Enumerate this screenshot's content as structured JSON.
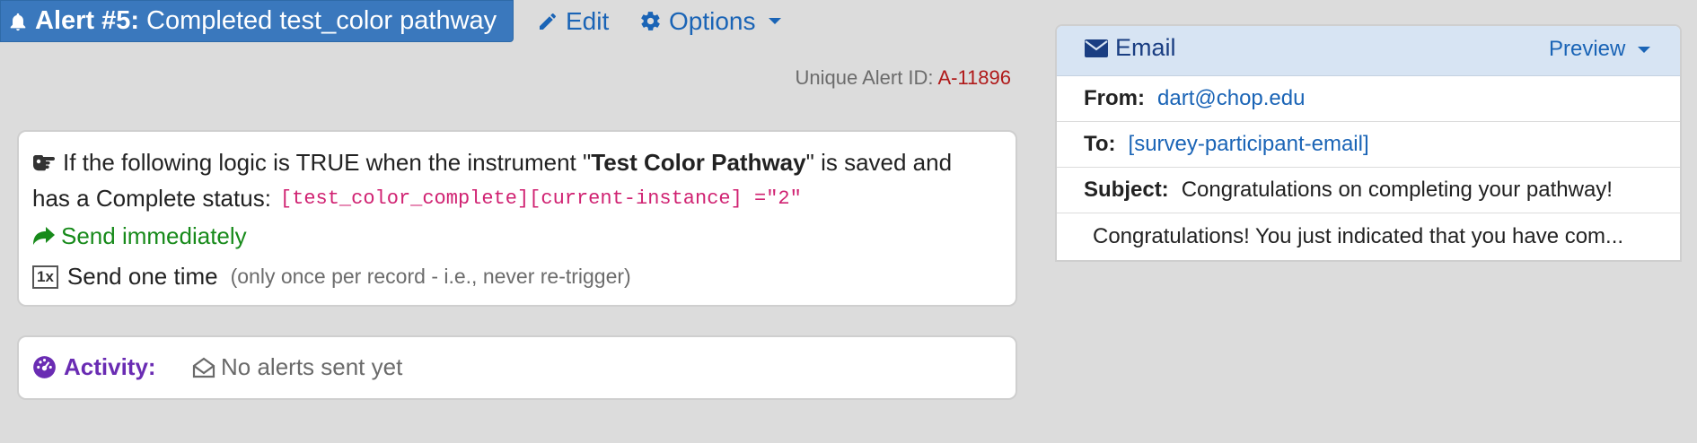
{
  "header": {
    "alert_label": "Alert #5:",
    "alert_name": "Completed test_color pathway",
    "edit_label": "Edit",
    "options_label": "Options"
  },
  "unique_id": {
    "label": "Unique Alert ID:",
    "value": "A-11896"
  },
  "logic": {
    "prefix": "If the following logic is TRUE when the instrument \"",
    "instrument": "Test Color Pathway",
    "suffix": "\" is saved and",
    "line2_prefix": "has a Complete status:",
    "expression": "[test_color_complete][current-instance] =\"2\"",
    "send_timing": "Send immediately",
    "badge": "1x",
    "send_frequency": "Send one time",
    "send_frequency_note": "(only once per record - i.e., never re-trigger)"
  },
  "activity": {
    "label": "Activity:",
    "value": "No alerts sent yet"
  },
  "email": {
    "title": "Email",
    "preview_label": "Preview",
    "from_label": "From:",
    "from_value": "dart@chop.edu",
    "to_label": "To:",
    "to_value": "[survey-participant-email]",
    "subject_label": "Subject:",
    "subject_value": "Congratulations on completing your pathway!",
    "body_preview": "Congratulations! You just indicated that you have com..."
  },
  "colors": {
    "header_blue": "#3a78bd",
    "link_blue": "#1a64b6",
    "alert_id_red": "#b01a1a",
    "code_pink": "#d02272",
    "send_green": "#178a1a",
    "activity_purple": "#6a2cb3",
    "email_header_bg": "#d7e4f3"
  }
}
